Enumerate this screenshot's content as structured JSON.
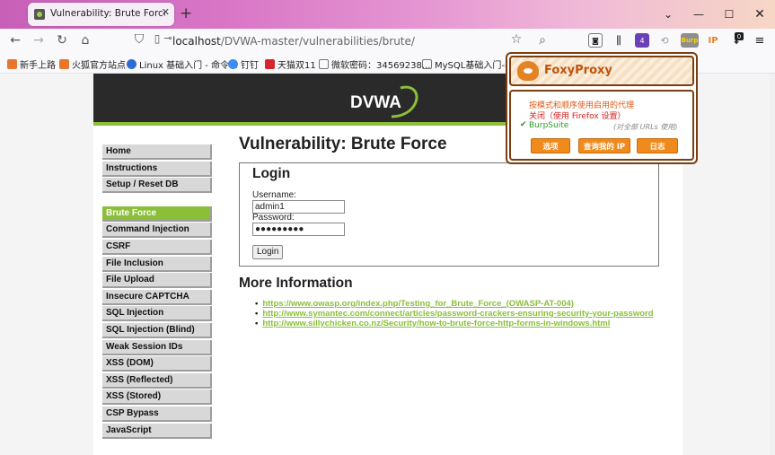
{
  "browser": {
    "tab_title": "Vulnerability: Brute Force :: D",
    "url_host": "localhost",
    "url_path": "/DVWA-master/vulnerabilities/brute/",
    "badge_count": "4",
    "badge_count_2": "0",
    "burp_label": "Burp",
    "ip_label": "IP"
  },
  "bookmarks": [
    {
      "label": "新手上路",
      "color": "#e8762c"
    },
    {
      "label": "火狐官方站点",
      "color": "#e8762c"
    },
    {
      "label": "Linux 基础入门 - 命令...",
      "color": "#2d6bd6"
    },
    {
      "label": "钉钉",
      "color": "#3b8cf0"
    },
    {
      "label": "天猫双11",
      "color": "#d8252a"
    },
    {
      "label": "微软密码：34569238...",
      "color": "#777777"
    },
    {
      "label": "MySQL基础入门-my",
      "color": "#777777"
    }
  ],
  "dvwa": {
    "logo_text": "DVWA",
    "menu_top": [
      "Home",
      "Instructions",
      "Setup / Reset DB"
    ],
    "menu_main": [
      "Brute Force",
      "Command Injection",
      "CSRF",
      "File Inclusion",
      "File Upload",
      "Insecure CAPTCHA",
      "SQL Injection",
      "SQL Injection (Blind)",
      "Weak Session IDs",
      "XSS (DOM)",
      "XSS (Reflected)",
      "XSS (Stored)",
      "CSP Bypass",
      "JavaScript"
    ],
    "heading": "Vulnerability: Brute Force",
    "login_heading": "Login",
    "username_label": "Username:",
    "username_value": "admin1",
    "password_label": "Password:",
    "password_value": "●●●●●●●●●",
    "login_button": "Login",
    "more_heading": "More Information",
    "links": [
      "https://www.owasp.org/index.php/Testing_for_Brute_Force_(OWASP-AT-004)",
      "http://www.symantec.com/connect/articles/password-crackers-ensuring-security-your-password",
      "http://www.sillychicken.co.nz/Security/how-to-brute-force-http-forms-in-windows.html"
    ]
  },
  "foxyproxy": {
    "title": "FoxyProxy",
    "mode_pattern": "按模式和顺序使用启用的代理",
    "mode_off": "关闭（使用 Firefox 设置）",
    "proxy_name": "BurpSuite",
    "proxy_note": "(对全部 URLs 使用)",
    "btn_options": "选项",
    "btn_ip": "查询我的 IP",
    "btn_log": "日志"
  }
}
